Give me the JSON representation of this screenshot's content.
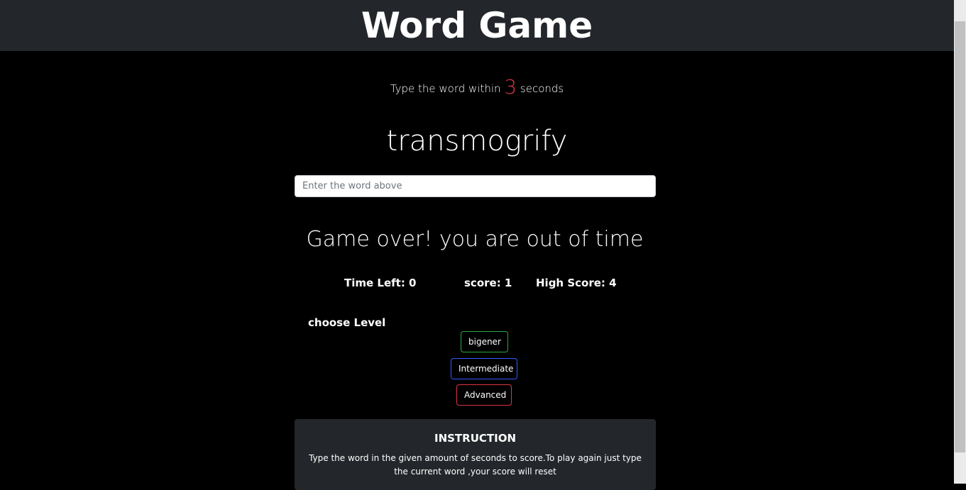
{
  "header": {
    "title": "Word Game"
  },
  "lead": {
    "prefix": "Type the word within",
    "seconds": "3",
    "suffix": "seconds"
  },
  "current_word": "transmogrify",
  "word_input": {
    "placeholder": "Enter the word above",
    "value": ""
  },
  "message": "Game over! you are out of time",
  "stats": {
    "time_left": "Time Left: 0",
    "score": "score: 1",
    "high_score": "High Score: 4"
  },
  "levels": {
    "label": "choose Level",
    "beginner": "bigener",
    "intermediate": "Intermediate",
    "advanced": "Advanced"
  },
  "instruction": {
    "title": "INSTRUCTION",
    "text": "Type the word in the given amount of seconds to score.To play again just type the current word ,your score will reset"
  },
  "colors": {
    "header_bg": "#23272b",
    "danger": "#dc3545",
    "success": "#28a745",
    "primary": "#2f5bff"
  }
}
